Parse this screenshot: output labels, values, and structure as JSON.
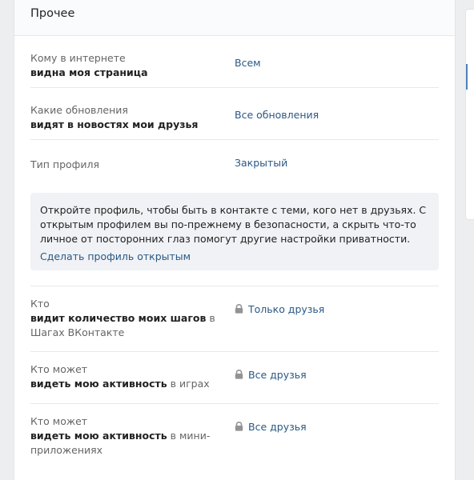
{
  "section": {
    "title": "Прочее"
  },
  "rows": [
    {
      "label_prefix": "Кому в интернете",
      "label_bold": "видна моя страница",
      "label_suffix": "",
      "value": "Всем",
      "locked": false
    },
    {
      "label_prefix": "Какие обновления",
      "label_bold_1": "видят",
      "label_plain_mid": " ",
      "label_bold": "в новостях мои друзья",
      "label_suffix": "",
      "value": "Все обновления",
      "locked": false
    },
    {
      "label_prefix": "Тип профиля",
      "value": "Закрытый",
      "locked": false
    }
  ],
  "info_box": {
    "text": "Откройте профиль, чтобы быть в контакте с теми, кого нет в друзьях. С открытым профилем вы по-прежнему в безопасности, а скрыть что-то личное от посторонних глаз помогут другие настройки приватности.",
    "link": "Сделать профиль открытым"
  },
  "locked_rows": [
    {
      "label_prefix": "Кто",
      "label_bold": "видит количество моих шагов",
      "label_suffix": " в Шагах ВКонтакте",
      "value": "Только друзья",
      "icon": "lock-icon"
    },
    {
      "label_prefix": "Кто может",
      "label_bold": "видеть мою активность",
      "label_suffix": " в играх",
      "value": "Все друзья",
      "icon": "lock-icon"
    },
    {
      "label_prefix": "Кто может",
      "label_bold": "видеть мою активность",
      "label_suffix": " в мини-приложениях",
      "value": "Все друзья",
      "icon": "lock-icon"
    }
  ],
  "colors": {
    "link": "#2a5885",
    "label": "#656565",
    "lock": "#939393",
    "background": "#edeef0"
  }
}
